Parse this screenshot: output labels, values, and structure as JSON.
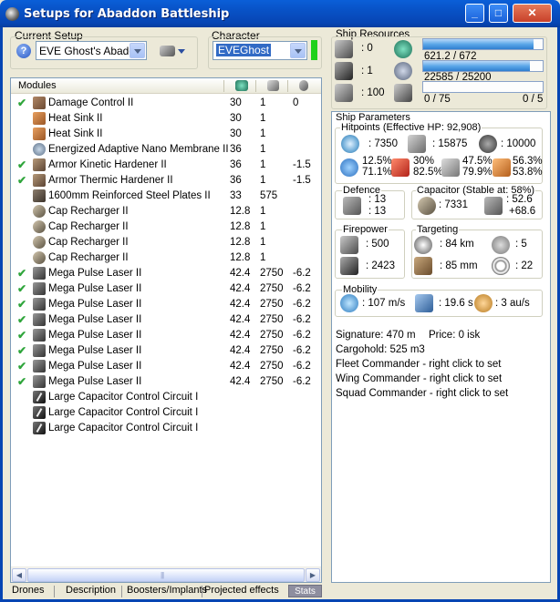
{
  "window": {
    "title": "Setups for Abaddon Battleship"
  },
  "current_setup": {
    "label": "Current Setup",
    "value": "EVE Ghost's Abaddo"
  },
  "character": {
    "label": "Character",
    "value": "EVEGhost"
  },
  "modules": {
    "header": "Modules",
    "rows": [
      {
        "checked": true,
        "name": "Damage Control II",
        "c1": "30",
        "c2": "1",
        "c3": "0",
        "icon": "dc"
      },
      {
        "checked": false,
        "name": "Heat Sink II",
        "c1": "30",
        "c2": "1",
        "c3": "",
        "icon": "hs"
      },
      {
        "checked": false,
        "name": "Heat Sink II",
        "c1": "30",
        "c2": "1",
        "c3": "",
        "icon": "hs"
      },
      {
        "checked": false,
        "name": "Energized Adaptive Nano Membrane II",
        "c1": "36",
        "c2": "1",
        "c3": "",
        "icon": "mem"
      },
      {
        "checked": true,
        "name": "Armor Kinetic Hardener II",
        "c1": "36",
        "c2": "1",
        "c3": "-1.5",
        "icon": "hard"
      },
      {
        "checked": true,
        "name": "Armor Thermic Hardener II",
        "c1": "36",
        "c2": "1",
        "c3": "-1.5",
        "icon": "hard"
      },
      {
        "checked": false,
        "name": "1600mm Reinforced Steel Plates II",
        "c1": "33",
        "c2": "575",
        "c3": "",
        "icon": "plate"
      },
      {
        "checked": false,
        "name": "Cap Recharger II",
        "c1": "12.8",
        "c2": "1",
        "c3": "",
        "icon": "cap"
      },
      {
        "checked": false,
        "name": "Cap Recharger II",
        "c1": "12.8",
        "c2": "1",
        "c3": "",
        "icon": "cap"
      },
      {
        "checked": false,
        "name": "Cap Recharger II",
        "c1": "12.8",
        "c2": "1",
        "c3": "",
        "icon": "cap"
      },
      {
        "checked": false,
        "name": "Cap Recharger II",
        "c1": "12.8",
        "c2": "1",
        "c3": "",
        "icon": "cap"
      },
      {
        "checked": true,
        "name": "Mega Pulse Laser II",
        "c1": "42.4",
        "c2": "2750",
        "c3": "-6.2",
        "icon": "laser"
      },
      {
        "checked": true,
        "name": "Mega Pulse Laser II",
        "c1": "42.4",
        "c2": "2750",
        "c3": "-6.2",
        "icon": "laser"
      },
      {
        "checked": true,
        "name": "Mega Pulse Laser II",
        "c1": "42.4",
        "c2": "2750",
        "c3": "-6.2",
        "icon": "laser"
      },
      {
        "checked": true,
        "name": "Mega Pulse Laser II",
        "c1": "42.4",
        "c2": "2750",
        "c3": "-6.2",
        "icon": "laser"
      },
      {
        "checked": true,
        "name": "Mega Pulse Laser II",
        "c1": "42.4",
        "c2": "2750",
        "c3": "-6.2",
        "icon": "laser"
      },
      {
        "checked": true,
        "name": "Mega Pulse Laser II",
        "c1": "42.4",
        "c2": "2750",
        "c3": "-6.2",
        "icon": "laser"
      },
      {
        "checked": true,
        "name": "Mega Pulse Laser II",
        "c1": "42.4",
        "c2": "2750",
        "c3": "-6.2",
        "icon": "laser"
      },
      {
        "checked": true,
        "name": "Mega Pulse Laser II",
        "c1": "42.4",
        "c2": "2750",
        "c3": "-6.2",
        "icon": "laser"
      },
      {
        "checked": false,
        "name": "Large Capacitor Control Circuit I",
        "c1": "",
        "c2": "",
        "c3": "",
        "icon": "circ"
      },
      {
        "checked": false,
        "name": "Large Capacitor Control Circuit I",
        "c1": "",
        "c2": "",
        "c3": "",
        "icon": "circ"
      },
      {
        "checked": false,
        "name": "Large Capacitor Control Circuit I",
        "c1": "",
        "c2": "",
        "c3": "",
        "icon": "circ"
      }
    ]
  },
  "resources": {
    "title": "Ship Resources",
    "turret_slots": ": 0",
    "launcher_slots": ": 1",
    "drone_bandwidth": ": 100",
    "cpu": "621.2 / 672",
    "cpu_fraction": 0.924,
    "powergrid": "22585 / 25200",
    "powergrid_fraction": 0.896,
    "calibration": "0 / 75",
    "calibration_fraction": 0,
    "rigs": "0 / 5"
  },
  "params": {
    "title": "Ship Parameters",
    "hitpoints_title": "Hitpoints (Effective HP: 92,908)",
    "shield_hp": ": 7350",
    "armor_hp": ": 15875",
    "structure_hp": ": 10000",
    "em_res_top": "12.5%",
    "em_res_bottom": "71.1%",
    "thermal_res_top": "30%",
    "thermal_res_bottom": "82.5%",
    "kinetic_res_top": "47.5%",
    "kinetic_res_bottom": "79.9%",
    "explosive_res_top": "56.3%",
    "explosive_res_bottom": "53.8%",
    "defence_title": "Defence",
    "defence_top": ": 13",
    "defence_bottom": ": 13",
    "capacitor_title": "Capacitor (Stable at: 58%)",
    "capacitor_value": ": 7331",
    "capacitor_top": ": 52.6",
    "capacitor_bottom": "+68.6",
    "firepower_title": "Firepower",
    "turret_dps": ": 500",
    "missile_dps": ": 2423",
    "targeting_title": "Targeting",
    "target_range": ": 84 km",
    "max_targets": ": 5",
    "scan_res": ": 85 mm",
    "sensor_strength": ": 22",
    "mobility_title": "Mobility",
    "max_velocity": ": 107 m/s",
    "align_time": ": 19.6 s",
    "warp_speed": ": 3 au/s",
    "signature": "Signature: 470 m",
    "price": "Price: 0 isk",
    "cargohold": "Cargohold: 525 m3",
    "fleet_commander": "Fleet Commander - right click to set",
    "wing_commander": "Wing Commander - right click to set",
    "squad_commander": "Squad Commander - right click to set"
  },
  "tabs": [
    "Drones",
    "Description",
    "Boosters/Implants",
    "Projected effects",
    "Stats"
  ],
  "icons": {
    "close": "close-icon",
    "minimize": "minimize-icon",
    "maximize": "maximize-icon",
    "help": "help-icon"
  }
}
